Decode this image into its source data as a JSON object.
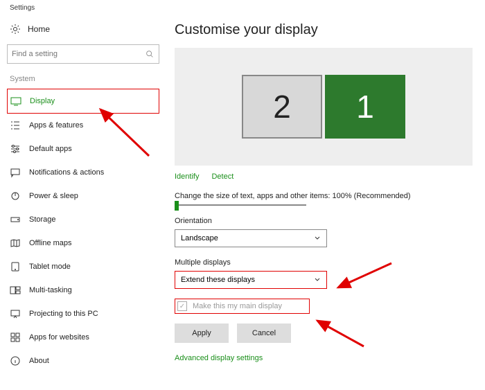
{
  "appTitle": "Settings",
  "sidebar": {
    "home": "Home",
    "searchPlaceholder": "Find a setting",
    "section": "System",
    "items": [
      {
        "label": "Display"
      },
      {
        "label": "Apps & features"
      },
      {
        "label": "Default apps"
      },
      {
        "label": "Notifications & actions"
      },
      {
        "label": "Power & sleep"
      },
      {
        "label": "Storage"
      },
      {
        "label": "Offline maps"
      },
      {
        "label": "Tablet mode"
      },
      {
        "label": "Multi-tasking"
      },
      {
        "label": "Projecting to this PC"
      },
      {
        "label": "Apps for websites"
      },
      {
        "label": "About"
      }
    ]
  },
  "main": {
    "title": "Customise your display",
    "monitors": {
      "left": "2",
      "right": "1"
    },
    "identify": "Identify",
    "detect": "Detect",
    "scaleLabel": "Change the size of text, apps and other items: 100% (Recommended)",
    "orientationLabel": "Orientation",
    "orientationValue": "Landscape",
    "multipleLabel": "Multiple displays",
    "multipleValue": "Extend these displays",
    "mainDisplayLabel": "Make this my main display",
    "apply": "Apply",
    "cancel": "Cancel",
    "advanced": "Advanced display settings"
  }
}
